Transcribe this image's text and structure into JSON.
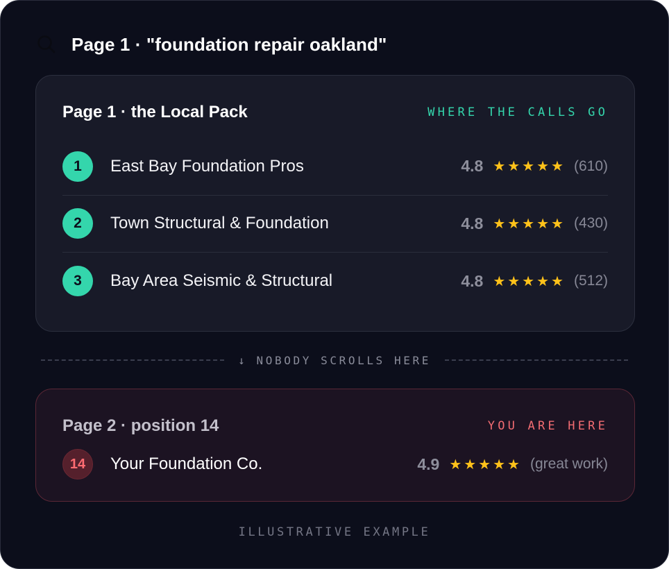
{
  "query": {
    "icon": "search-icon",
    "text": "Page 1 · \"foundation repair oakland\""
  },
  "local_pack": {
    "title": "Page 1 · the Local Pack",
    "tag": "WHERE THE CALLS GO",
    "accent": "#34d6ac",
    "results": [
      {
        "rank": "1",
        "name": "East Bay Foundation Pros",
        "score": "4.8",
        "stars": 5,
        "count": "(610)"
      },
      {
        "rank": "2",
        "name": "Town Structural & Foundation",
        "score": "4.8",
        "stars": 5,
        "count": "(430)"
      },
      {
        "rank": "3",
        "name": "Bay Area Seismic & Structural",
        "score": "4.8",
        "stars": 5,
        "count": "(512)"
      }
    ]
  },
  "divider": {
    "text": "↓ NOBODY SCROLLS HERE"
  },
  "your_listing": {
    "title": "Page 2 · position 14",
    "tag": "YOU ARE HERE",
    "accent": "#f26c72",
    "rank": "14",
    "name": "Your Foundation Co.",
    "score": "4.9",
    "stars": 5,
    "note": "(great work)"
  },
  "footer": {
    "text": "ILLUSTRATIVE EXAMPLE"
  },
  "colors": {
    "background": "#0c0e1b",
    "star": "#ffc21a"
  }
}
